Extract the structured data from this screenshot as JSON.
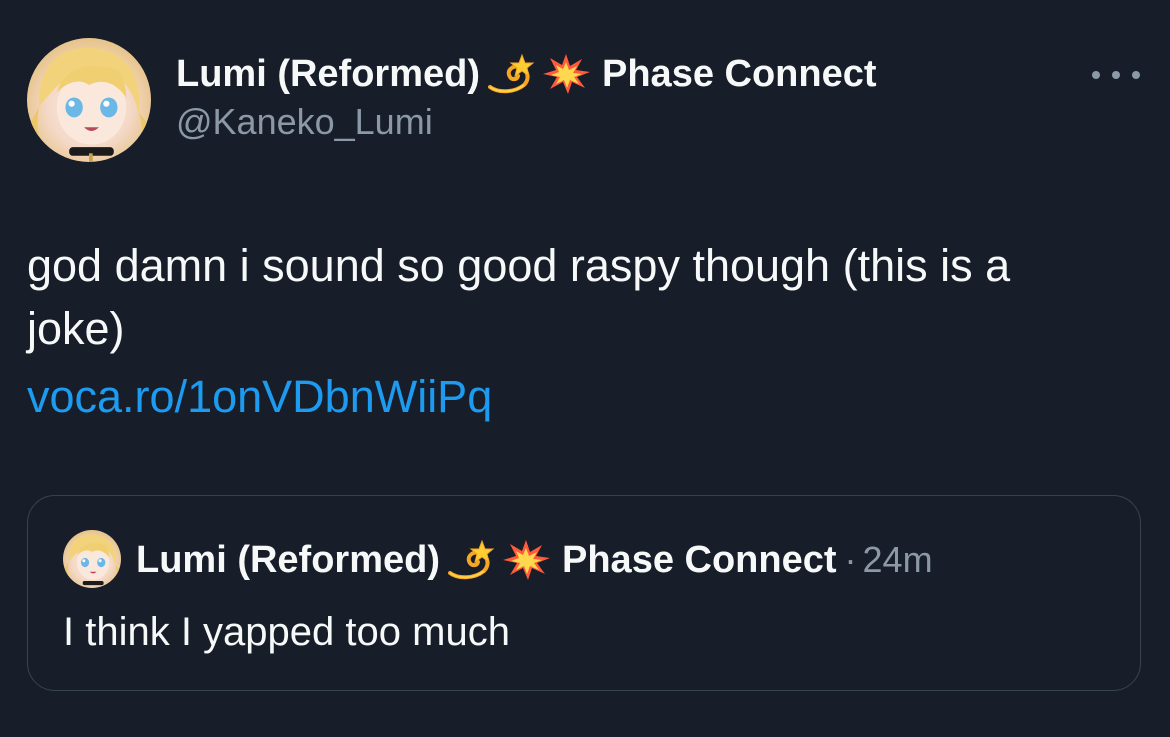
{
  "tweet": {
    "author": {
      "display_name": "Lumi (Reformed)",
      "name_emojis": [
        "dizzy-emoji",
        "collision-emoji"
      ],
      "affiliation": "Phase Connect",
      "handle": "@Kaneko_Lumi"
    },
    "more_icon": "more-icon",
    "text": "god damn i sound so good raspy though (this is a joke)",
    "link": "voca.ro/1onVDbnWiiPq",
    "quote": {
      "author": {
        "display_name": "Lumi (Reformed)",
        "affiliation": "Phase Connect",
        "separator": "·",
        "time": "24m"
      },
      "text": "I think I yapped too much"
    }
  },
  "colors": {
    "background": "#171e29",
    "text_primary": "#f7f9f9",
    "text_secondary": "#8b98a5",
    "link": "#1d9bf0",
    "border": "#38444d"
  }
}
